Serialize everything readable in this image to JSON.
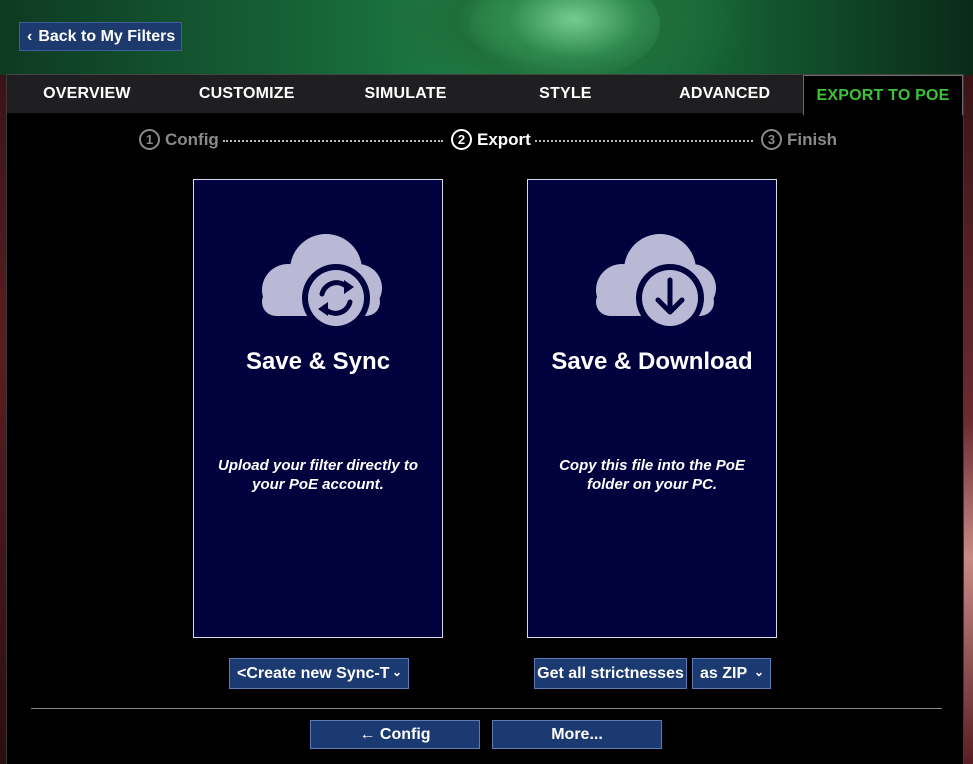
{
  "header": {
    "back_label": "Back to My Filters"
  },
  "tabs": [
    {
      "label": "OVERVIEW",
      "active": false
    },
    {
      "label": "CUSTOMIZE",
      "active": false
    },
    {
      "label": "SIMULATE",
      "active": false
    },
    {
      "label": "STYLE",
      "active": false
    },
    {
      "label": "ADVANCED",
      "active": false
    },
    {
      "label": "EXPORT TO POE",
      "active": true
    }
  ],
  "steps": [
    {
      "num": "1",
      "label": "Config",
      "state": "done"
    },
    {
      "num": "2",
      "label": "Export",
      "state": "current"
    },
    {
      "num": "3",
      "label": "Finish",
      "state": "pending"
    }
  ],
  "cards": {
    "sync": {
      "title": "Save & Sync",
      "description": "Upload your filter directly to your PoE account.",
      "icon": "cloud-sync-icon",
      "select_value": "<Create new Sync-T"
    },
    "download": {
      "title": "Save & Download",
      "description": "Copy this file into the PoE folder on your PC.",
      "icon": "cloud-download-icon",
      "strictness_button": "Get all strictnesses",
      "format_select": "as ZIP"
    }
  },
  "footer": {
    "config_button": "← Config",
    "more_button": "More..."
  },
  "colors": {
    "accent_active_tab": "#3ec23a",
    "card_bg": "#01013e",
    "button_bg": "#1b3a72"
  }
}
